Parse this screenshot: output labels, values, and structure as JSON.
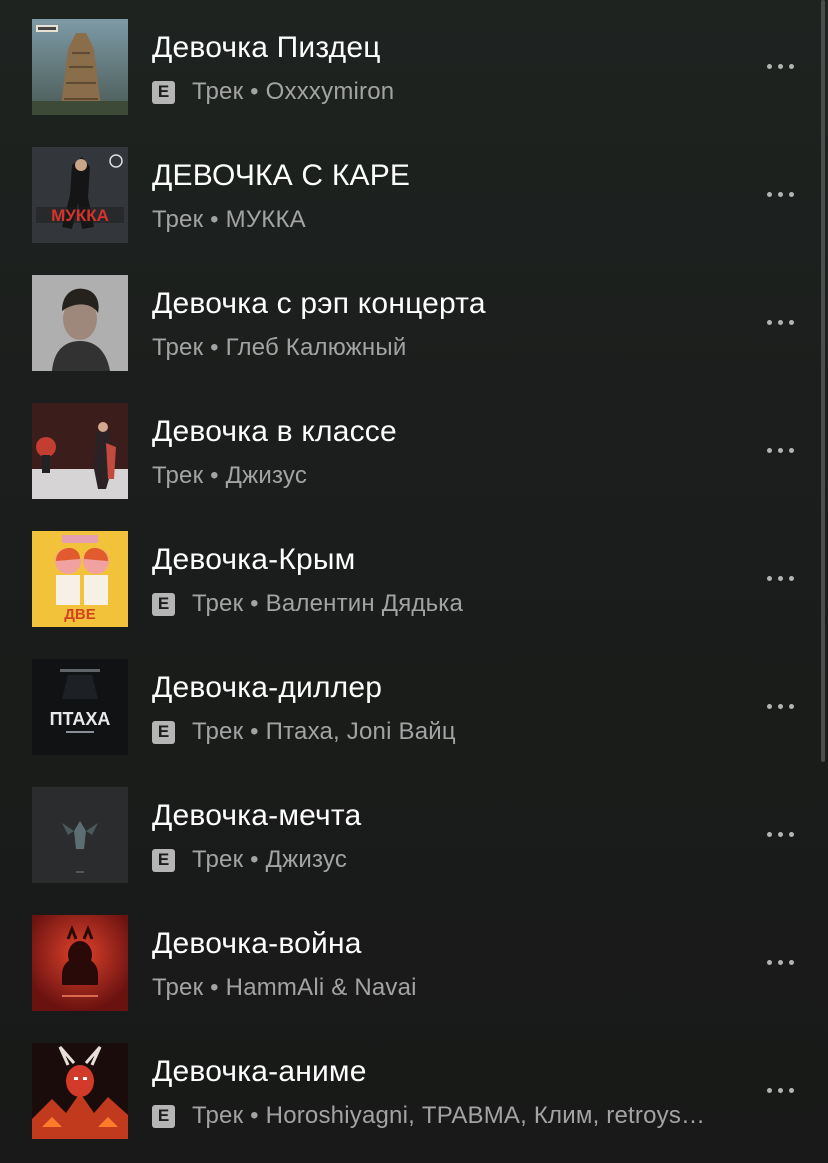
{
  "tracks": [
    {
      "title": "Девочка Пиздец",
      "type": "Трек",
      "artist": "Oxxxymiron",
      "explicit": true,
      "explicit_label": "E",
      "cover": "tower-cover"
    },
    {
      "title": "ДЕВОЧКА С КАРЕ",
      "type": "Трек",
      "artist": "МУККА",
      "explicit": false,
      "explicit_label": "",
      "cover": "mukka-cover"
    },
    {
      "title": "Девочка с рэп концерта",
      "type": "Трек",
      "artist": "Глеб Калюжный",
      "explicit": false,
      "explicit_label": "",
      "cover": "portrait-cover"
    },
    {
      "title": "Девочка в классе",
      "type": "Трек",
      "artist": "Джизус",
      "explicit": false,
      "explicit_label": "",
      "cover": "stage-cover"
    },
    {
      "title": "Девочка-Крым",
      "type": "Трек",
      "artist": "Валентин Дядька",
      "explicit": true,
      "explicit_label": "E",
      "cover": "yellow-cover"
    },
    {
      "title": "Девочка-диллер",
      "type": "Трек",
      "artist": "Птаха, Joni Вайц",
      "explicit": true,
      "explicit_label": "E",
      "cover": "ptaha-cover"
    },
    {
      "title": "Девочка-мечта",
      "type": "Трек",
      "artist": "Джизус",
      "explicit": true,
      "explicit_label": "E",
      "cover": "dark-cover"
    },
    {
      "title": "Девочка-война",
      "type": "Трек",
      "artist": "HammAli & Navai",
      "explicit": false,
      "explicit_label": "",
      "cover": "red-cover"
    },
    {
      "title": "Девочка-аниме",
      "type": "Трек",
      "artist": "Horoshiyagni, ТРАВМА, Клим, retroys…",
      "explicit": true,
      "explicit_label": "E",
      "cover": "demon-cover"
    }
  ],
  "meta_separator": " • ",
  "more_icon": "more-horizontal-icon",
  "colors": {
    "background": "#1b1e1c",
    "title": "#ffffff",
    "subtitle": "#a3a3a3",
    "explicit_badge": "#b5b5b5"
  }
}
